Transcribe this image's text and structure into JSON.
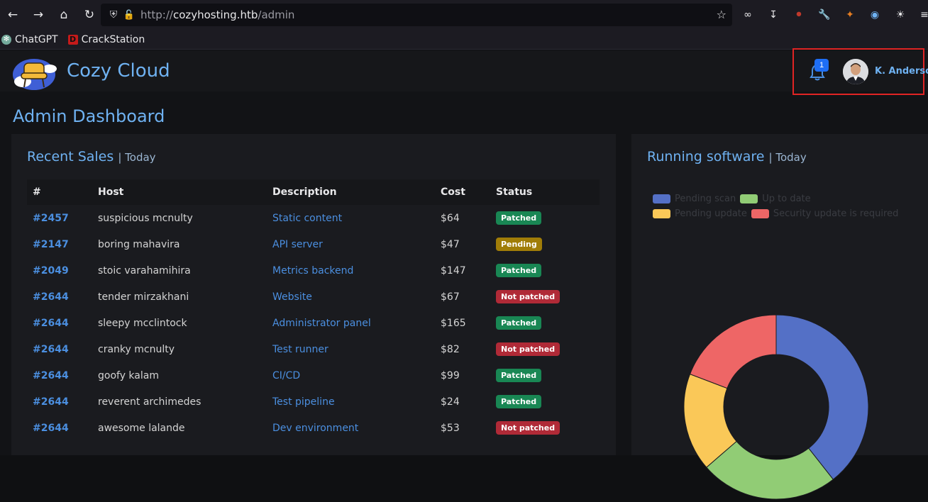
{
  "browser": {
    "url_prefix": "http://",
    "url_host": "cozyhosting.htb",
    "url_path": "/admin",
    "bookmarks": [
      {
        "label": "ChatGPT"
      },
      {
        "label": "CrackStation"
      }
    ]
  },
  "header": {
    "brand": "Cozy Cloud",
    "notification_count": "1",
    "user_name": "K. Anderson"
  },
  "page_title": "Admin Dashboard",
  "sales": {
    "title": "Recent Sales",
    "subtitle": "| Today",
    "columns": [
      "#",
      "Host",
      "Description",
      "Cost",
      "Status"
    ],
    "rows": [
      {
        "id": "#2457",
        "host": "suspicious mcnulty",
        "desc": "Static content",
        "cost": "$64",
        "status": "Patched"
      },
      {
        "id": "#2147",
        "host": "boring mahavira",
        "desc": "API server",
        "cost": "$47",
        "status": "Pending"
      },
      {
        "id": "#2049",
        "host": "stoic varahamihira",
        "desc": "Metrics backend",
        "cost": "$147",
        "status": "Patched"
      },
      {
        "id": "#2644",
        "host": "tender mirzakhani",
        "desc": "Website",
        "cost": "$67",
        "status": "Not patched"
      },
      {
        "id": "#2644",
        "host": "sleepy mcclintock",
        "desc": "Administrator panel",
        "cost": "$165",
        "status": "Patched"
      },
      {
        "id": "#2644",
        "host": "cranky mcnulty",
        "desc": "Test runner",
        "cost": "$82",
        "status": "Not patched"
      },
      {
        "id": "#2644",
        "host": "goofy kalam",
        "desc": "CI/CD",
        "cost": "$99",
        "status": "Patched"
      },
      {
        "id": "#2644",
        "host": "reverent archimedes",
        "desc": "Test pipeline",
        "cost": "$24",
        "status": "Patched"
      },
      {
        "id": "#2644",
        "host": "awesome lalande",
        "desc": "Dev environment",
        "cost": "$53",
        "status": "Not patched"
      }
    ],
    "status_colors": {
      "Patched": "#198754",
      "Pending": "#a07d08",
      "Not patched": "#b02a37"
    }
  },
  "software": {
    "title": "Running software",
    "subtitle": "| Today",
    "chart_data": {
      "type": "pie",
      "categories": [
        "Pending scan",
        "Up to date",
        "Pending update",
        "Security update is required"
      ],
      "values": [
        39,
        24,
        17,
        19
      ],
      "colors": [
        "#5470c6",
        "#91cc75",
        "#fac858",
        "#ee6666"
      ],
      "legend": "top-left"
    }
  }
}
